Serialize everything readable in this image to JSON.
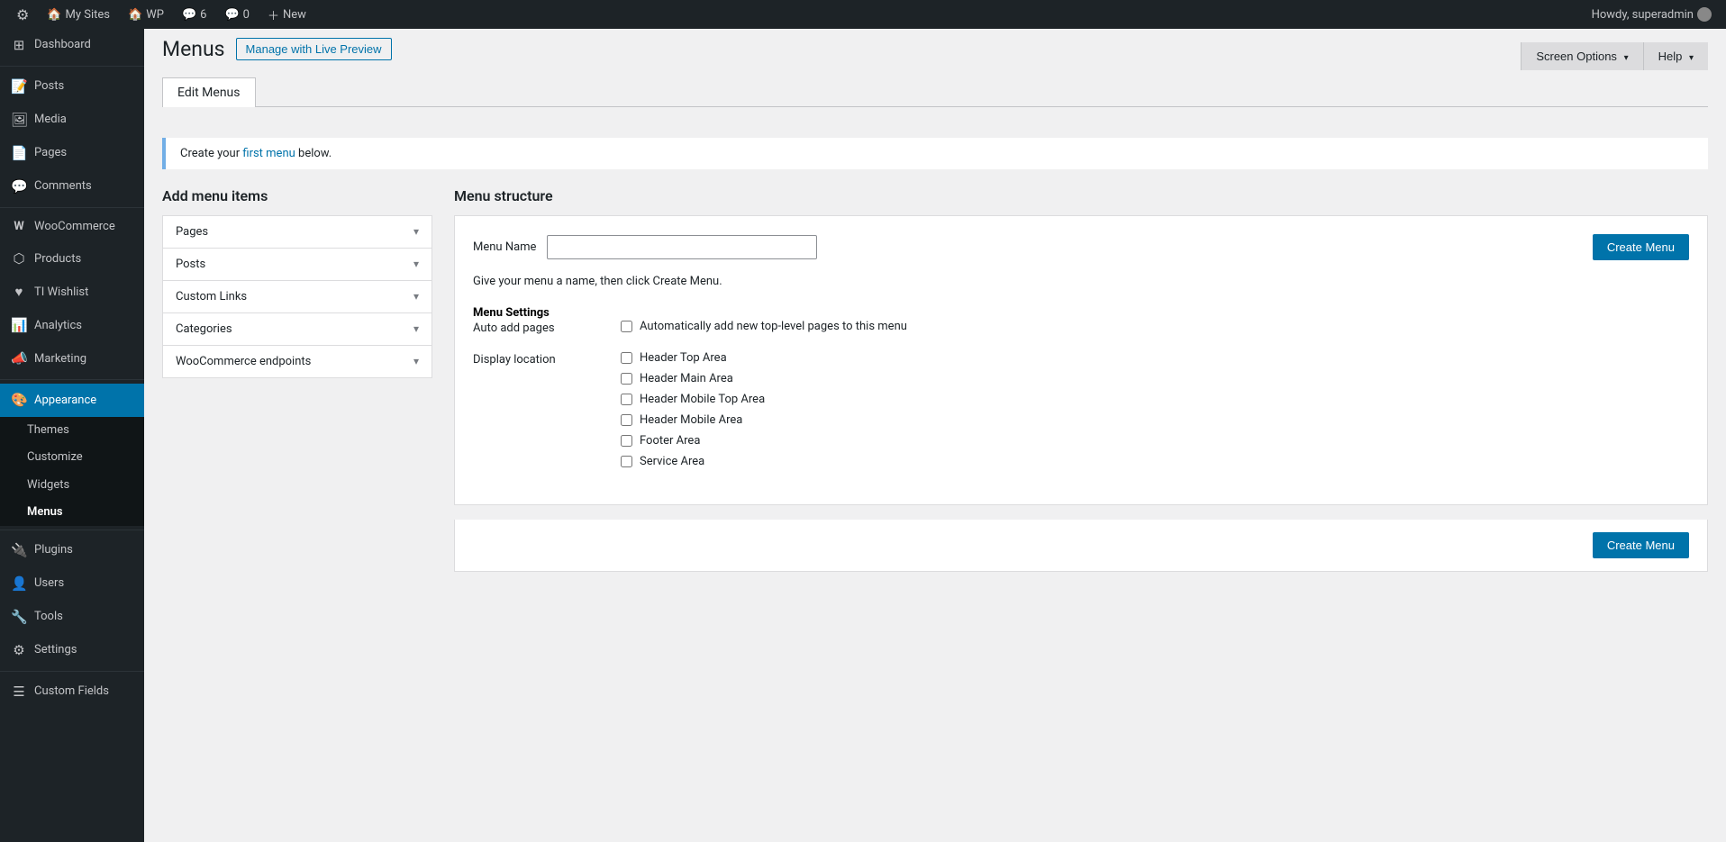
{
  "adminbar": {
    "items": [
      {
        "icon": "⚙",
        "label": "WordPress logo"
      },
      {
        "icon": "🏠",
        "label": "My Sites"
      },
      {
        "icon": "🏠",
        "label": "WP"
      },
      {
        "icon": "💬",
        "label": "6"
      },
      {
        "icon": "💬",
        "label": "0"
      },
      {
        "icon": "+",
        "label": "New"
      }
    ],
    "user": "Howdy, superadmin"
  },
  "sidebar": {
    "items": [
      {
        "id": "dashboard",
        "icon": "⊞",
        "label": "Dashboard"
      },
      {
        "id": "posts",
        "icon": "📝",
        "label": "Posts"
      },
      {
        "id": "media",
        "icon": "🖼",
        "label": "Media"
      },
      {
        "id": "pages",
        "icon": "📄",
        "label": "Pages"
      },
      {
        "id": "comments",
        "icon": "💬",
        "label": "Comments"
      },
      {
        "id": "woocommerce",
        "icon": "W",
        "label": "WooCommerce"
      },
      {
        "id": "products",
        "icon": "⬡",
        "label": "Products"
      },
      {
        "id": "ti-wishlist",
        "icon": "♥",
        "label": "TI Wishlist"
      },
      {
        "id": "analytics",
        "icon": "📊",
        "label": "Analytics"
      },
      {
        "id": "marketing",
        "icon": "📣",
        "label": "Marketing"
      },
      {
        "id": "appearance",
        "icon": "🎨",
        "label": "Appearance"
      },
      {
        "id": "plugins",
        "icon": "🔌",
        "label": "Plugins"
      },
      {
        "id": "users",
        "icon": "👤",
        "label": "Users"
      },
      {
        "id": "tools",
        "icon": "🔧",
        "label": "Tools"
      },
      {
        "id": "settings",
        "icon": "⚙",
        "label": "Settings"
      },
      {
        "id": "custom-fields",
        "icon": "☰",
        "label": "Custom Fields"
      }
    ],
    "submenu_appearance": [
      {
        "id": "themes",
        "label": "Themes"
      },
      {
        "id": "customize",
        "label": "Customize"
      },
      {
        "id": "widgets",
        "label": "Widgets"
      },
      {
        "id": "menus",
        "label": "Menus",
        "active": true
      }
    ]
  },
  "header": {
    "title": "Menus",
    "live_preview_btn": "Manage with Live Preview",
    "screen_options": "Screen Options",
    "help": "Help"
  },
  "tabs": [
    {
      "id": "edit-menus",
      "label": "Edit Menus",
      "active": true
    }
  ],
  "notice": {
    "text": "Create your first menu below.",
    "link_text": "first menu",
    "link_url": "#"
  },
  "add_menu_items": {
    "title": "Add menu items",
    "sections": [
      {
        "id": "pages",
        "label": "Pages"
      },
      {
        "id": "posts",
        "label": "Posts"
      },
      {
        "id": "custom-links",
        "label": "Custom Links"
      },
      {
        "id": "categories",
        "label": "Categories"
      },
      {
        "id": "woocommerce-endpoints",
        "label": "WooCommerce endpoints"
      }
    ]
  },
  "menu_structure": {
    "title": "Menu structure",
    "menu_name_label": "Menu Name",
    "menu_name_placeholder": "",
    "create_menu_btn": "Create Menu",
    "hint": "Give your menu a name, then click Create Menu.",
    "settings": {
      "title": "Menu Settings",
      "auto_add_label": "Auto add pages",
      "auto_add_checkbox": "Automatically add new top-level pages to this menu",
      "display_location_label": "Display location",
      "locations": [
        {
          "id": "header-top",
          "label": "Header Top Area"
        },
        {
          "id": "header-main",
          "label": "Header Main Area"
        },
        {
          "id": "header-mobile-top",
          "label": "Header Mobile Top Area"
        },
        {
          "id": "header-mobile",
          "label": "Header Mobile Area"
        },
        {
          "id": "footer",
          "label": "Footer Area"
        },
        {
          "id": "service",
          "label": "Service Area"
        }
      ]
    },
    "bottom_create_btn": "Create Menu"
  },
  "colors": {
    "admin_bar_bg": "#1d2327",
    "sidebar_bg": "#1d2327",
    "active_item_bg": "#0073aa",
    "accent": "#0073aa",
    "text_primary": "#1d2327",
    "text_muted": "#787c82",
    "border": "#dcdcde"
  }
}
